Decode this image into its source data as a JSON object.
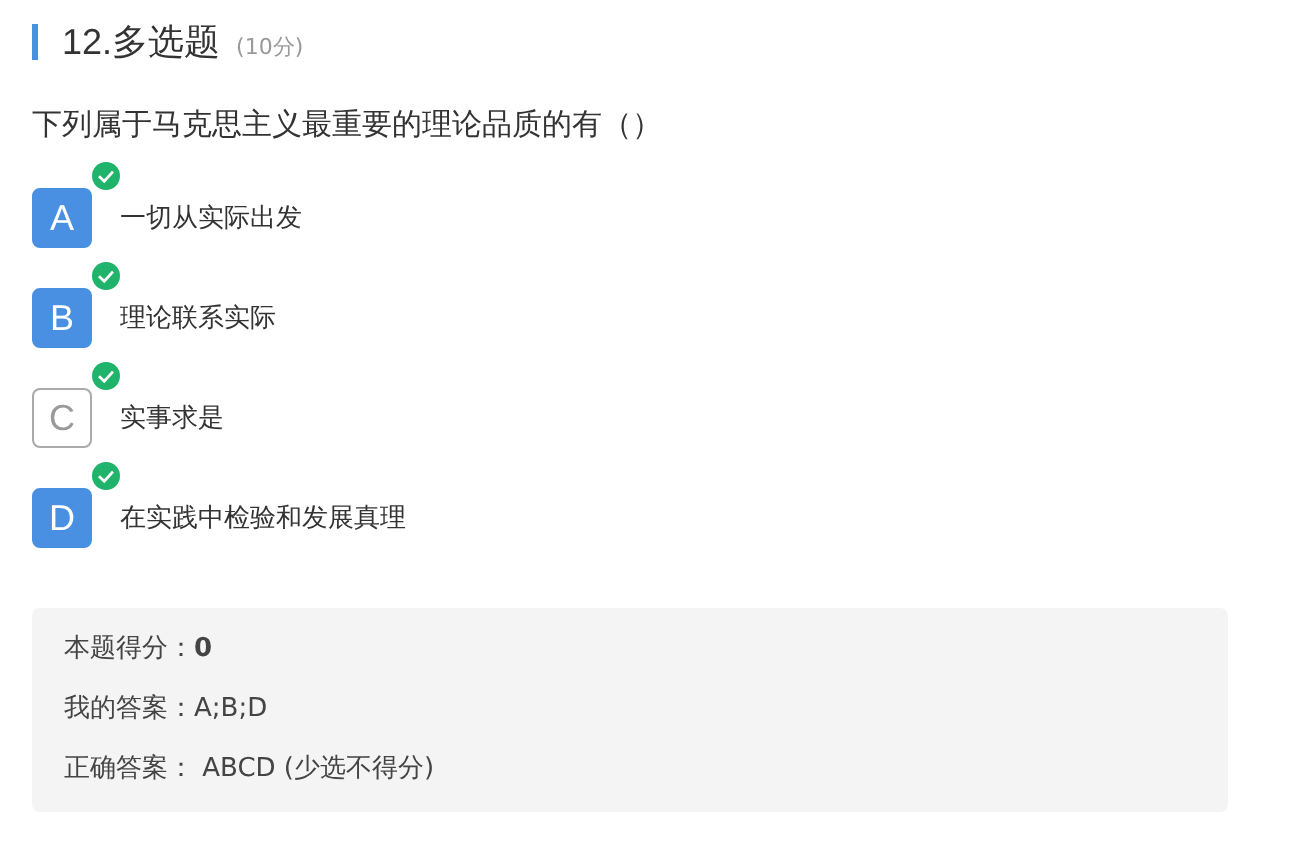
{
  "header": {
    "title": "12.多选题",
    "score": "(10分)"
  },
  "question": "下列属于马克思主义最重要的理论品质的有（）",
  "options": [
    {
      "letter": "A",
      "text": "一切从实际出发",
      "selected": true,
      "correct": true
    },
    {
      "letter": "B",
      "text": "理论联系实际",
      "selected": true,
      "correct": true
    },
    {
      "letter": "C",
      "text": "实事求是",
      "selected": false,
      "correct": true
    },
    {
      "letter": "D",
      "text": "在实践中检验和发展真理",
      "selected": true,
      "correct": true
    }
  ],
  "result": [
    "本题得分：**0**",
    "我的答案：A;B;D",
    "正确答案： ABCD (少选不得分)"
  ]
}
